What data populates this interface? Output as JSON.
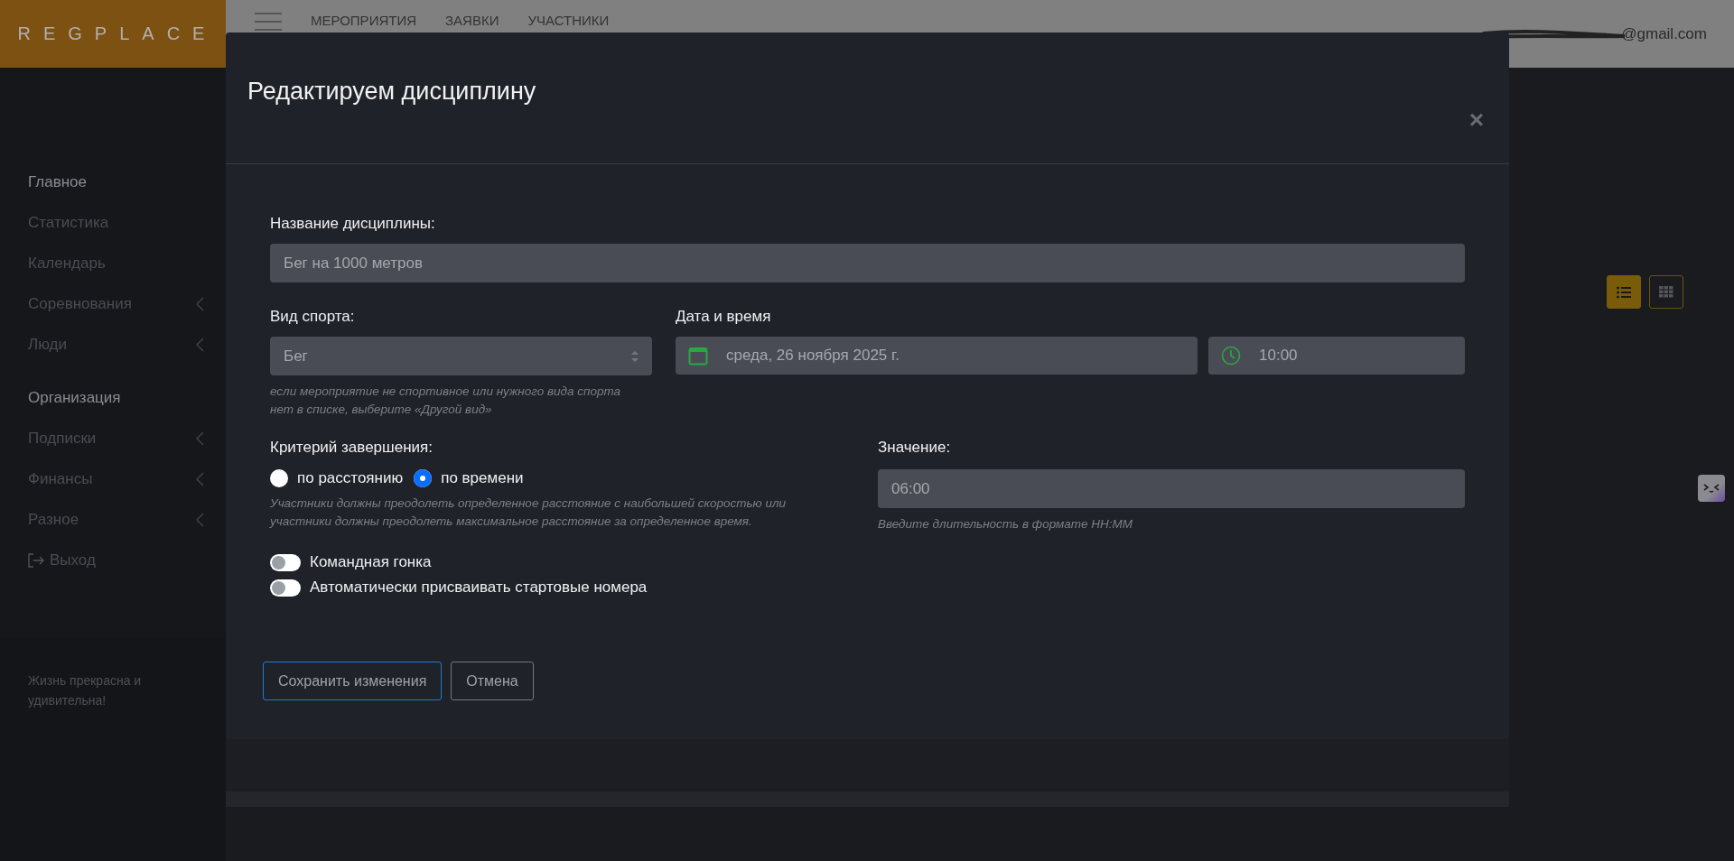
{
  "header": {
    "brand": "REGPLACE",
    "nav": [
      {
        "label": "МЕРОПРИЯТИЯ"
      },
      {
        "label": "ЗАЯВКИ"
      },
      {
        "label": "УЧАСТНИКИ"
      }
    ],
    "user_email": "@gmail.com"
  },
  "sidebar": {
    "items": [
      {
        "label": "Главное",
        "kind": "section",
        "expandable": false
      },
      {
        "label": "Статистика",
        "kind": "link",
        "expandable": false
      },
      {
        "label": "Календарь",
        "kind": "link",
        "expandable": false
      },
      {
        "label": "Соревнования",
        "kind": "link",
        "expandable": true
      },
      {
        "label": "Люди",
        "kind": "link",
        "expandable": true
      },
      {
        "label": "Организация",
        "kind": "section",
        "expandable": false
      },
      {
        "label": "Подписки",
        "kind": "link",
        "expandable": true
      },
      {
        "label": "Финансы",
        "kind": "link",
        "expandable": true
      },
      {
        "label": "Разное",
        "kind": "link",
        "expandable": true
      },
      {
        "label": "Выход",
        "kind": "logout",
        "expandable": false
      }
    ],
    "footer_text": "Жизнь прекрасна и удивительна!"
  },
  "view_toggle": [
    {
      "kind": "list",
      "selected": true
    },
    {
      "kind": "grid",
      "selected": false
    }
  ],
  "modal": {
    "title": "Редактируем дисциплину",
    "close": "×",
    "name_field": {
      "label": "Название дисциплины:",
      "value": "Бег на 1000 метров"
    },
    "sport_field": {
      "label": "Вид спорта:",
      "value": "Бег",
      "help": "если мероприятие не спортивное или нужного вида спорта нет в списке, выберите «Другой вид»"
    },
    "datetime": {
      "label": "Дата и время",
      "date": "среда, 26 ноября 2025 г.",
      "time": "10:00"
    },
    "criterion": {
      "label": "Критерий завершения:",
      "options": [
        {
          "label": "по расстоянию",
          "selected": false
        },
        {
          "label": "по времени",
          "selected": true
        }
      ],
      "help": "Участники должны преодолеть определенное расстояние с наибольшей скоростью или участники должны преодолеть максимальное расстояние за определенное время."
    },
    "value_field": {
      "label": "Значение:",
      "value": "06:00",
      "help": "Введите длительность в формате HH:MM"
    },
    "toggles": [
      {
        "label": "Командная гонка",
        "on": false
      },
      {
        "label": "Автоматически присваивать стартовые номера",
        "on": false
      }
    ],
    "buttons": [
      {
        "label": "Сохранить изменения",
        "kind": "primary"
      },
      {
        "label": "Отмена",
        "kind": "secondary"
      }
    ]
  }
}
